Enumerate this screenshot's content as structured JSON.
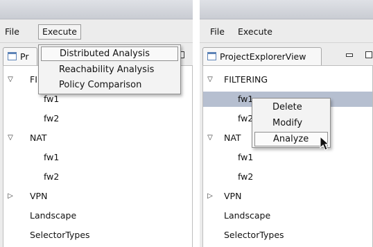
{
  "left_window": {
    "menu": {
      "file": "File",
      "execute": "Execute"
    },
    "view_tab": {
      "label": "Pr",
      "icon": "view-icon"
    },
    "tree": [
      {
        "label": "FI",
        "expanded": true,
        "children": []
      },
      {
        "label": "fw1"
      },
      {
        "label": "fw2"
      },
      {
        "label": "NAT",
        "expanded": true
      },
      {
        "label": "fw1"
      },
      {
        "label": "fw2"
      },
      {
        "label": "VPN",
        "expanded": false
      },
      {
        "label": "Landscape"
      },
      {
        "label": "SelectorTypes"
      }
    ],
    "execute_menu": {
      "items": [
        "Distributed Analysis",
        "Reachability Analysis",
        "Policy Comparison"
      ],
      "highlighted": "Distributed Analysis"
    }
  },
  "right_window": {
    "menu": {
      "file": "File",
      "execute": "Execute"
    },
    "view_tab": {
      "label": "ProjectExplorerView",
      "icon": "view-icon"
    },
    "tree": [
      {
        "label": "FILTERING",
        "expanded": true
      },
      {
        "label": "fw1",
        "selected": true
      },
      {
        "label": "fw2"
      },
      {
        "label": "NAT",
        "expanded": true
      },
      {
        "label": "fw1"
      },
      {
        "label": "fw2"
      },
      {
        "label": "VPN",
        "expanded": false
      },
      {
        "label": "Landscape"
      },
      {
        "label": "SelectorTypes"
      }
    ],
    "context_menu": {
      "items": [
        "Delete",
        "Modify",
        "Analyze"
      ],
      "highlighted": "Analyze"
    }
  },
  "colors": {
    "selection": "#b6bfd0",
    "titlebar": "#c9ccd3",
    "menubar": "#ececec"
  }
}
